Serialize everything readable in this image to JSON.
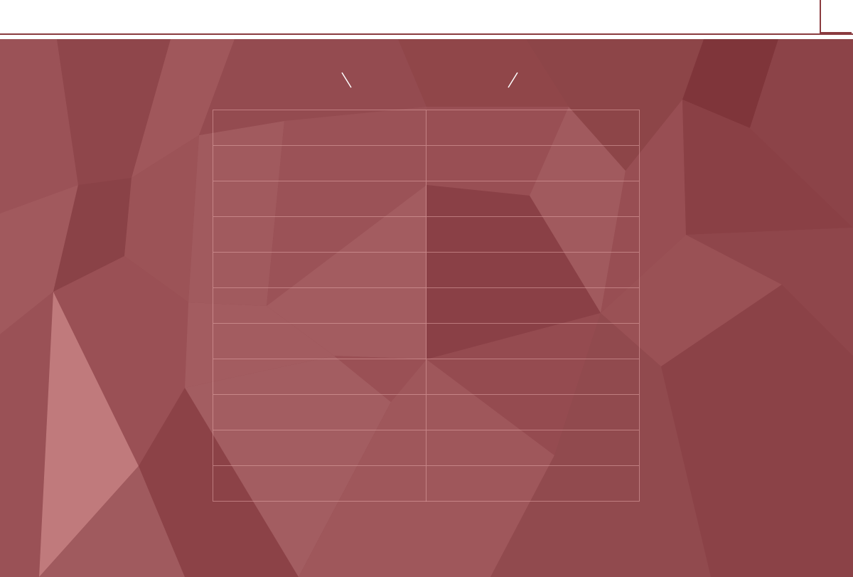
{
  "page": {
    "title": "",
    "colors": {
      "accent": "#8a3b3f",
      "background_base": "#954a4f",
      "background_light": "#c07a7c",
      "background_dark": "#843a3f",
      "grid_line": "#e6aaaa"
    }
  },
  "topbar": {
    "title": "",
    "corner_button_label": ""
  },
  "header": {
    "left_label": "",
    "right_label": ""
  },
  "grid": {
    "rows": [
      [
        "",
        ""
      ],
      [
        "",
        ""
      ],
      [
        "",
        ""
      ],
      [
        "",
        ""
      ],
      [
        "",
        ""
      ],
      [
        "",
        ""
      ],
      [
        "",
        ""
      ],
      [
        "",
        ""
      ],
      [
        "",
        ""
      ],
      [
        "",
        ""
      ],
      [
        "",
        ""
      ]
    ]
  }
}
